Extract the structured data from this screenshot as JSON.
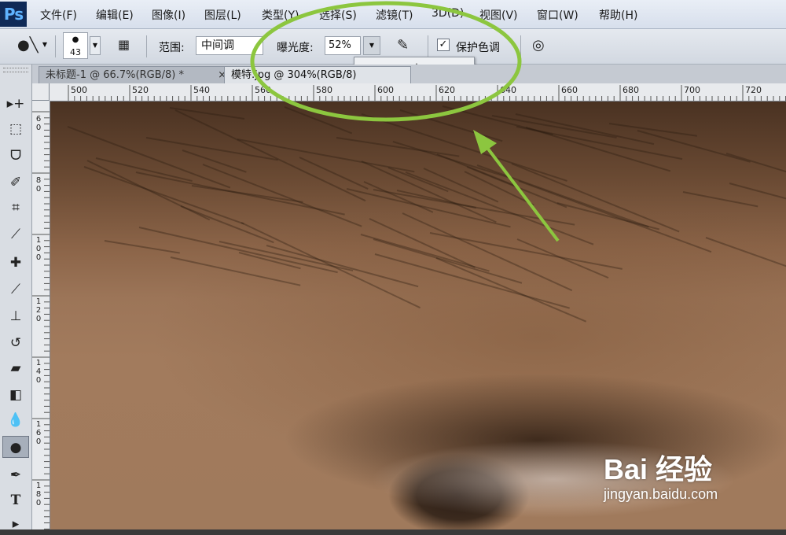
{
  "app": {
    "logo": "Ps"
  },
  "menu": [
    "文件(F)",
    "编辑(E)",
    "图像(I)",
    "图层(L)",
    "类型(Y)",
    "选择(S)",
    "滤镜(T)",
    "3D(D)",
    "视图(V)",
    "窗口(W)",
    "帮助(H)"
  ],
  "options": {
    "brush_size": "43",
    "range_label": "范围:",
    "range_value": "中间调",
    "exposure_label": "曝光度:",
    "exposure_value": "52%",
    "exposure_level": 0.52,
    "protect_tones_label": "保护色调",
    "protect_tones_checked": true
  },
  "tabs": [
    {
      "label": "未标题-1 @ 66.7%(RGB/8) *",
      "close": "×"
    },
    {
      "label": "模特.jpg @ 304%(RGB/8)"
    }
  ],
  "ruler": {
    "horizontal": [
      "500",
      "520",
      "540",
      "560",
      "580",
      "600",
      "620",
      "640",
      "660",
      "680",
      "700",
      "720"
    ],
    "vertical": [
      "6 0",
      "8 0",
      "1 0 0",
      "1 2 0",
      "1 4 0",
      "1 6 0",
      "1 8 0"
    ]
  },
  "tools": [
    "move-tool",
    "marquee-tool",
    "lasso-tool",
    "quick-select-tool",
    "crop-tool",
    "eyedropper-tool",
    "healing-tool",
    "brush-tool",
    "stamp-tool",
    "history-brush-tool",
    "eraser-tool",
    "gradient-tool",
    "blur-tool",
    "dodge-burn-tool",
    "pen-tool",
    "type-tool",
    "path-select-tool"
  ],
  "watermark": {
    "brand": "Bai 经验",
    "url": "jingyan.baidu.com"
  },
  "annotation_color": "#8cc63f"
}
